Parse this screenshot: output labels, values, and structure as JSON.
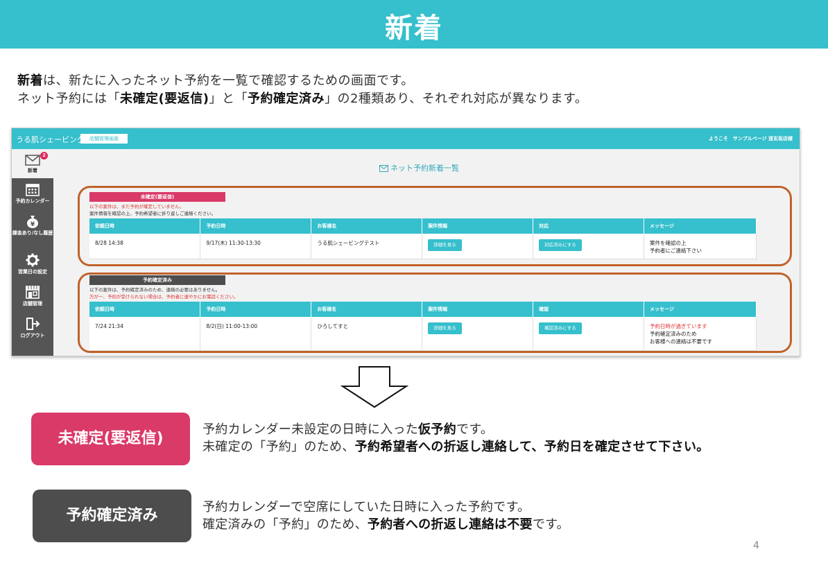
{
  "title": "新着",
  "intro": {
    "line1_bold": "新着",
    "line1_rest": "は、新たに入ったネット予約を一覧で確認するための画面です。",
    "line2_a": "ネット予約には「",
    "line2_b": "未確定(要返信)",
    "line2_c": "」と「",
    "line2_d": "予約確定済み",
    "line2_e": "」の2種類あり、それぞれ対応が異なります。"
  },
  "app": {
    "brand": "うる肌シェービング",
    "admin_button": "店舗管理画面",
    "welcome": "ようこそ　サンプルページ 道玄坂店様",
    "page_heading": "ネット予約新着一覧",
    "sidebar": {
      "items": [
        {
          "label": "新着",
          "icon": "mail-icon",
          "badge": "2"
        },
        {
          "label": "予約カレンダー",
          "icon": "calendar-icon"
        },
        {
          "label": "課金あり/なし履歴",
          "icon": "money-bag-icon"
        },
        {
          "label": "営業日の設定",
          "icon": "gear-icon"
        },
        {
          "label": "店舗管理",
          "icon": "store-icon"
        },
        {
          "label": "ログアウト",
          "icon": "logout-icon"
        }
      ]
    },
    "unconfirmed": {
      "tag": "未確定(要返信)",
      "note1": "以下の案件は、まだ予約が確定していません。",
      "note2": "案件情報を確認の上、予約希望者に折り返しご連絡ください。",
      "headers": [
        "依頼日時",
        "予約日時",
        "お客様名",
        "案件情報",
        "対応",
        "メッセージ"
      ],
      "row": {
        "request": "8/28 14:38",
        "reserve": "9/17(木) 11:30-13:30",
        "customer": "うる肌シェービングテスト",
        "detail_btn": "詳細を見る",
        "action_btn": "対応済みにする",
        "msg1": "案件を確認の上",
        "msg2": "予約者にご連絡下さい"
      }
    },
    "confirmed": {
      "tag": "予約確定済み",
      "note1": "以下の案件は、予約確定済みのため、連絡の必要はありません。",
      "note2": "万が一、予約が受けられない場合は、予約者に速やかにお電話ください。",
      "headers": [
        "依頼日時",
        "予約日時",
        "お客様名",
        "案件情報",
        "確認",
        "メッセージ"
      ],
      "row": {
        "request": "7/24 21:34",
        "reserve": "8/2(日) 11:00-13:00",
        "customer": "ひろしてすと",
        "detail_btn": "詳細を見る",
        "action_btn": "確認済みにする",
        "msg1": "予約日時が過ぎています",
        "msg2": "予約確定済みのため",
        "msg3": "お客様への連絡は不要です"
      }
    }
  },
  "explain": {
    "pink_tag": "未確定(要返信)",
    "pink_l1_a": "予約カレンダー未設定の日時に入った",
    "pink_l1_b": "仮予約",
    "pink_l1_c": "です。",
    "pink_l2_a": "未確定の「予約」のため、",
    "pink_l2_b": "予約希望者への折返し連絡して、予約日を確定させて下さい。",
    "gray_tag": "予約確定済み",
    "gray_l1": "予約カレンダーで空席にしていた日時に入った予約です。",
    "gray_l2_a": "確定済みの「予約」のため、",
    "gray_l2_b": "予約者への折返し連絡は不要",
    "gray_l2_c": "です。"
  },
  "page_number": "4",
  "colors": {
    "accent": "#36bfcc",
    "pink": "#d93a68",
    "gray": "#4d4d4d",
    "highlight": "#c0622a"
  }
}
